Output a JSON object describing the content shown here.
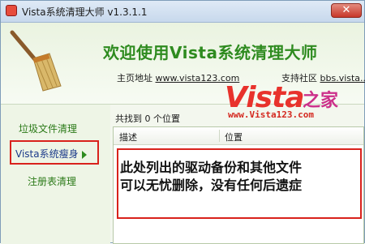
{
  "window": {
    "title": "Vista系统清理大师 v1.3.1.1"
  },
  "header": {
    "welcome": "欢迎使用Vista系统清理大师",
    "homepage_label": "主页地址",
    "homepage_url": "www.vista123.com",
    "support_label": "支持社区",
    "support_url": "bbs.vista..."
  },
  "watermark": {
    "logo": "Vista",
    "logo_suffix": "之家",
    "url": "www.Vista123.com"
  },
  "sidebar": {
    "items": [
      {
        "label": "垃圾文件清理"
      },
      {
        "label": "Vista系统瘦身"
      },
      {
        "label": "注册表清理"
      }
    ]
  },
  "main": {
    "found_text": "共找到 0 个位置",
    "columns": [
      "描述",
      "位置"
    ],
    "note_lines": [
      "此处列出的驱动备份和其他文件",
      "可以无忧删除，没有任何后遗症"
    ]
  },
  "colors": {
    "accent_green": "#2e8b1f",
    "highlight_red": "#d9221c"
  }
}
